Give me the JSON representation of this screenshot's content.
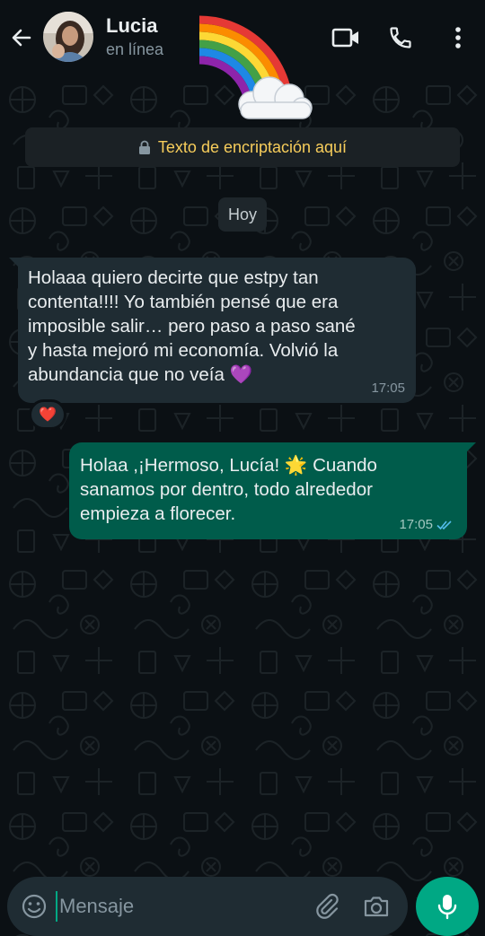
{
  "header": {
    "contact_name": "Lucia",
    "status": "en línea"
  },
  "icons": {
    "back": "arrow-left-icon",
    "video": "video-camera-icon",
    "call": "phone-icon",
    "menu": "more-vertical-icon",
    "lock": "lock-icon",
    "emoji": "emoji-icon",
    "attach": "paperclip-icon",
    "camera": "camera-icon",
    "mic": "microphone-icon"
  },
  "chat": {
    "encryption_notice": "Texto de encriptación aquí",
    "date_chip": "Hoy",
    "messages": [
      {
        "direction": "incoming",
        "text": "Holaaa quiero decirte que estpy tan\ncontenta!!!! Yo también pensé que era\nimposible salir… pero paso a paso sané\ny hasta mejoró mi economía. Volvió la\nabundancia que no veía 💜",
        "time": "17:05",
        "reaction": "❤️"
      },
      {
        "direction": "outgoing",
        "text": "Holaa ,¡Hermoso, Lucía! 🌟 Cuando\nsanamos por dentro, todo alrededor\nempieza a florecer.",
        "time": "17:05",
        "status": "read"
      }
    ]
  },
  "composer": {
    "placeholder": "Mensaje"
  },
  "colors": {
    "background": "#0b1014",
    "incoming_bubble": "#1f2c33",
    "outgoing_bubble": "#005c4b",
    "accent": "#00a884",
    "encryption_text": "#f7cd5b",
    "read_ticks": "#53bdeb"
  }
}
